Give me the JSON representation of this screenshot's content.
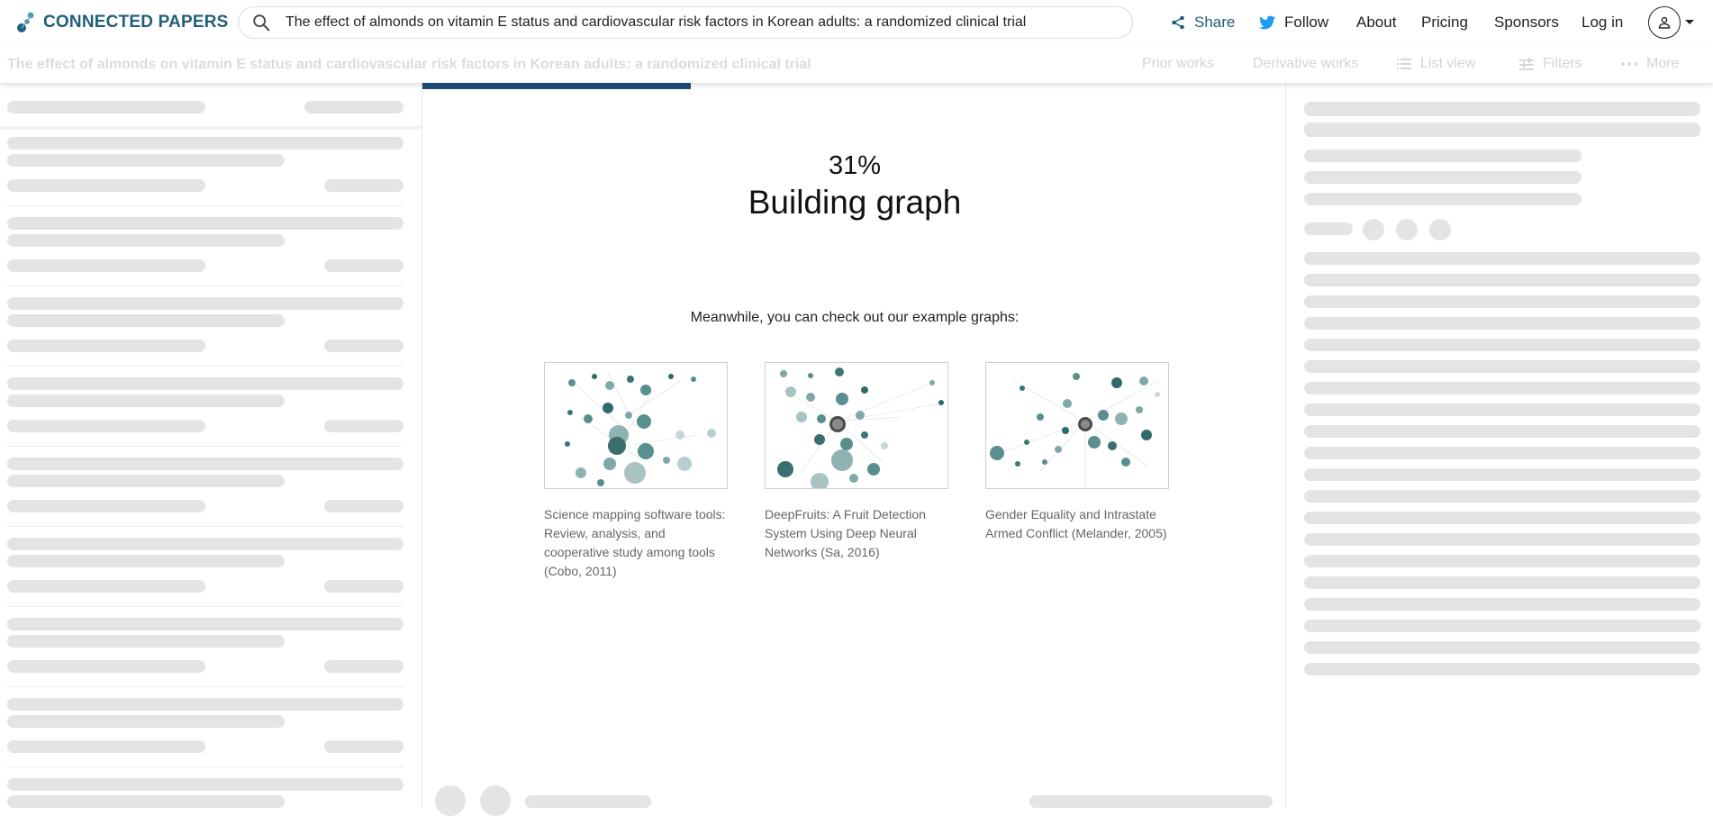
{
  "app": {
    "logo_text": "CONNECTED PAPERS",
    "brand_color": "#1f5f7a"
  },
  "search": {
    "value": "The effect of almonds on vitamin E status and cardiovascular risk factors in Korean adults: a randomized clinical trial",
    "icon": "search-icon"
  },
  "nav": {
    "share": "Share",
    "follow": "Follow",
    "about": "About",
    "pricing": "Pricing",
    "sponsors": "Sponsors",
    "login": "Log in"
  },
  "titlebar": {
    "title": "The effect of almonds on vitamin E status and cardiovascular risk factors in Korean adults: a randomized clinical trial",
    "prior_works": "Prior works",
    "derivative_works": "Derivative works",
    "list_view": "List view",
    "filters": "Filters",
    "more": "More"
  },
  "graph": {
    "progress_fraction": 0.31,
    "percent": "31%",
    "status": "Building graph",
    "meanwhile": "Meanwhile, you can check out our example graphs:",
    "accent": "#1f4e79"
  },
  "examples": [
    {
      "caption": "Science mapping software tools: Review, analysis, and cooperative study among tools (Cobo, 2011)"
    },
    {
      "caption": "DeepFruits: A Fruit Detection System Using Deep Neural Networks (Sa, 2016)"
    },
    {
      "caption": "Gender Equality and Intrastate Armed Conflict (Melander, 2005)"
    }
  ]
}
